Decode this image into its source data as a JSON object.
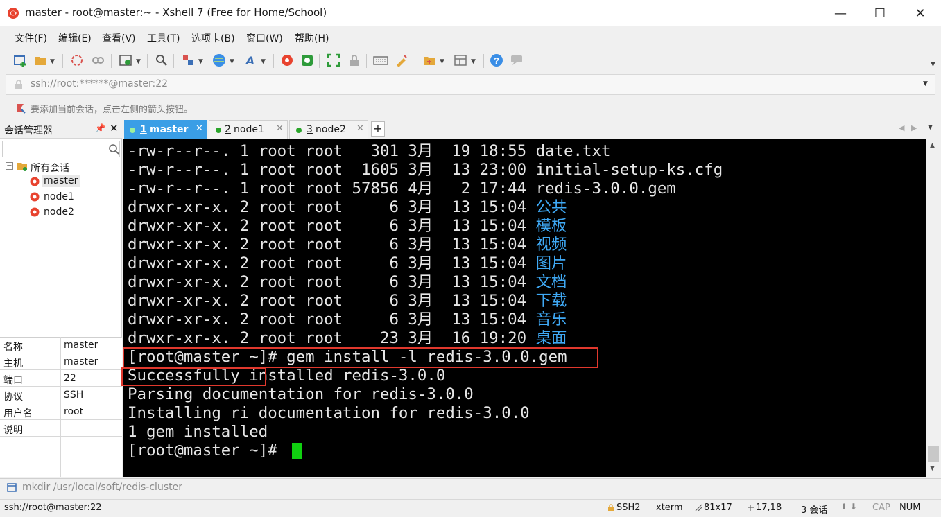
{
  "window": {
    "title": "master - root@master:~ - Xshell 7 (Free for Home/School)",
    "controls": [
      "—",
      "☐",
      "✕"
    ]
  },
  "menu": [
    "文件(F)",
    "编辑(E)",
    "查看(V)",
    "工具(T)",
    "选项卡(B)",
    "窗口(W)",
    "帮助(H)"
  ],
  "address": {
    "value": "ssh://root:******@master:22"
  },
  "hint": {
    "text": "要添加当前会话，点击左侧的箭头按钮。"
  },
  "session_manager": {
    "title": "会话管理器",
    "tree_root": "所有会话",
    "sessions": [
      "master",
      "node1",
      "node2"
    ],
    "properties": [
      {
        "key": "名称",
        "value": "master"
      },
      {
        "key": "主机",
        "value": "master"
      },
      {
        "key": "端口",
        "value": "22"
      },
      {
        "key": "协议",
        "value": "SSH"
      },
      {
        "key": "用户名",
        "value": "root"
      },
      {
        "key": "说明",
        "value": ""
      }
    ]
  },
  "tabs": [
    {
      "num": "1",
      "label": "master",
      "active": true
    },
    {
      "num": "2",
      "label": "node1",
      "active": false
    },
    {
      "num": "3",
      "label": "node2",
      "active": false
    }
  ],
  "terminal": {
    "listing": [
      {
        "perm": "-rw-r--r--.",
        "links": "1",
        "user": "root",
        "group": "root",
        "size": "301",
        "month": "3月",
        "day": "19",
        "time": "18:55",
        "name": "date.txt",
        "dir": false
      },
      {
        "perm": "-rw-r--r--.",
        "links": "1",
        "user": "root",
        "group": "root",
        "size": "1605",
        "month": "3月",
        "day": "13",
        "time": "23:00",
        "name": "initial-setup-ks.cfg",
        "dir": false
      },
      {
        "perm": "-rw-r--r--.",
        "links": "1",
        "user": "root",
        "group": "root",
        "size": "57856",
        "month": "4月",
        "day": "2",
        "time": "17:44",
        "name": "redis-3.0.0.gem",
        "dir": false
      },
      {
        "perm": "drwxr-xr-x.",
        "links": "2",
        "user": "root",
        "group": "root",
        "size": "6",
        "month": "3月",
        "day": "13",
        "time": "15:04",
        "name": "公共",
        "dir": true
      },
      {
        "perm": "drwxr-xr-x.",
        "links": "2",
        "user": "root",
        "group": "root",
        "size": "6",
        "month": "3月",
        "day": "13",
        "time": "15:04",
        "name": "模板",
        "dir": true
      },
      {
        "perm": "drwxr-xr-x.",
        "links": "2",
        "user": "root",
        "group": "root",
        "size": "6",
        "month": "3月",
        "day": "13",
        "time": "15:04",
        "name": "视频",
        "dir": true
      },
      {
        "perm": "drwxr-xr-x.",
        "links": "2",
        "user": "root",
        "group": "root",
        "size": "6",
        "month": "3月",
        "day": "13",
        "time": "15:04",
        "name": "图片",
        "dir": true
      },
      {
        "perm": "drwxr-xr-x.",
        "links": "2",
        "user": "root",
        "group": "root",
        "size": "6",
        "month": "3月",
        "day": "13",
        "time": "15:04",
        "name": "文档",
        "dir": true
      },
      {
        "perm": "drwxr-xr-x.",
        "links": "2",
        "user": "root",
        "group": "root",
        "size": "6",
        "month": "3月",
        "day": "13",
        "time": "15:04",
        "name": "下载",
        "dir": true
      },
      {
        "perm": "drwxr-xr-x.",
        "links": "2",
        "user": "root",
        "group": "root",
        "size": "6",
        "month": "3月",
        "day": "13",
        "time": "15:04",
        "name": "音乐",
        "dir": true
      },
      {
        "perm": "drwxr-xr-x.",
        "links": "2",
        "user": "root",
        "group": "root",
        "size": "23",
        "month": "3月",
        "day": "16",
        "time": "19:20",
        "name": "桌面",
        "dir": true
      }
    ],
    "output": [
      "[root@master ~]# gem install -l redis-3.0.0.gem",
      "Successfully installed redis-3.0.0",
      "Parsing documentation for redis-3.0.0",
      "Installing ri documentation for redis-3.0.0",
      "1 gem installed",
      "[root@master ~]# "
    ],
    "dir_color": "#3fa9f5",
    "cursor_color": "#10d010"
  },
  "command_bar": {
    "text": "mkdir /usr/local/soft/redis-cluster"
  },
  "status": {
    "connection": "ssh://root@master:22",
    "protocol": "SSH2",
    "term": "xterm",
    "size": "81x17",
    "position": "17,18",
    "sessions": "3 会话",
    "caps": "CAP",
    "num": "NUM"
  }
}
